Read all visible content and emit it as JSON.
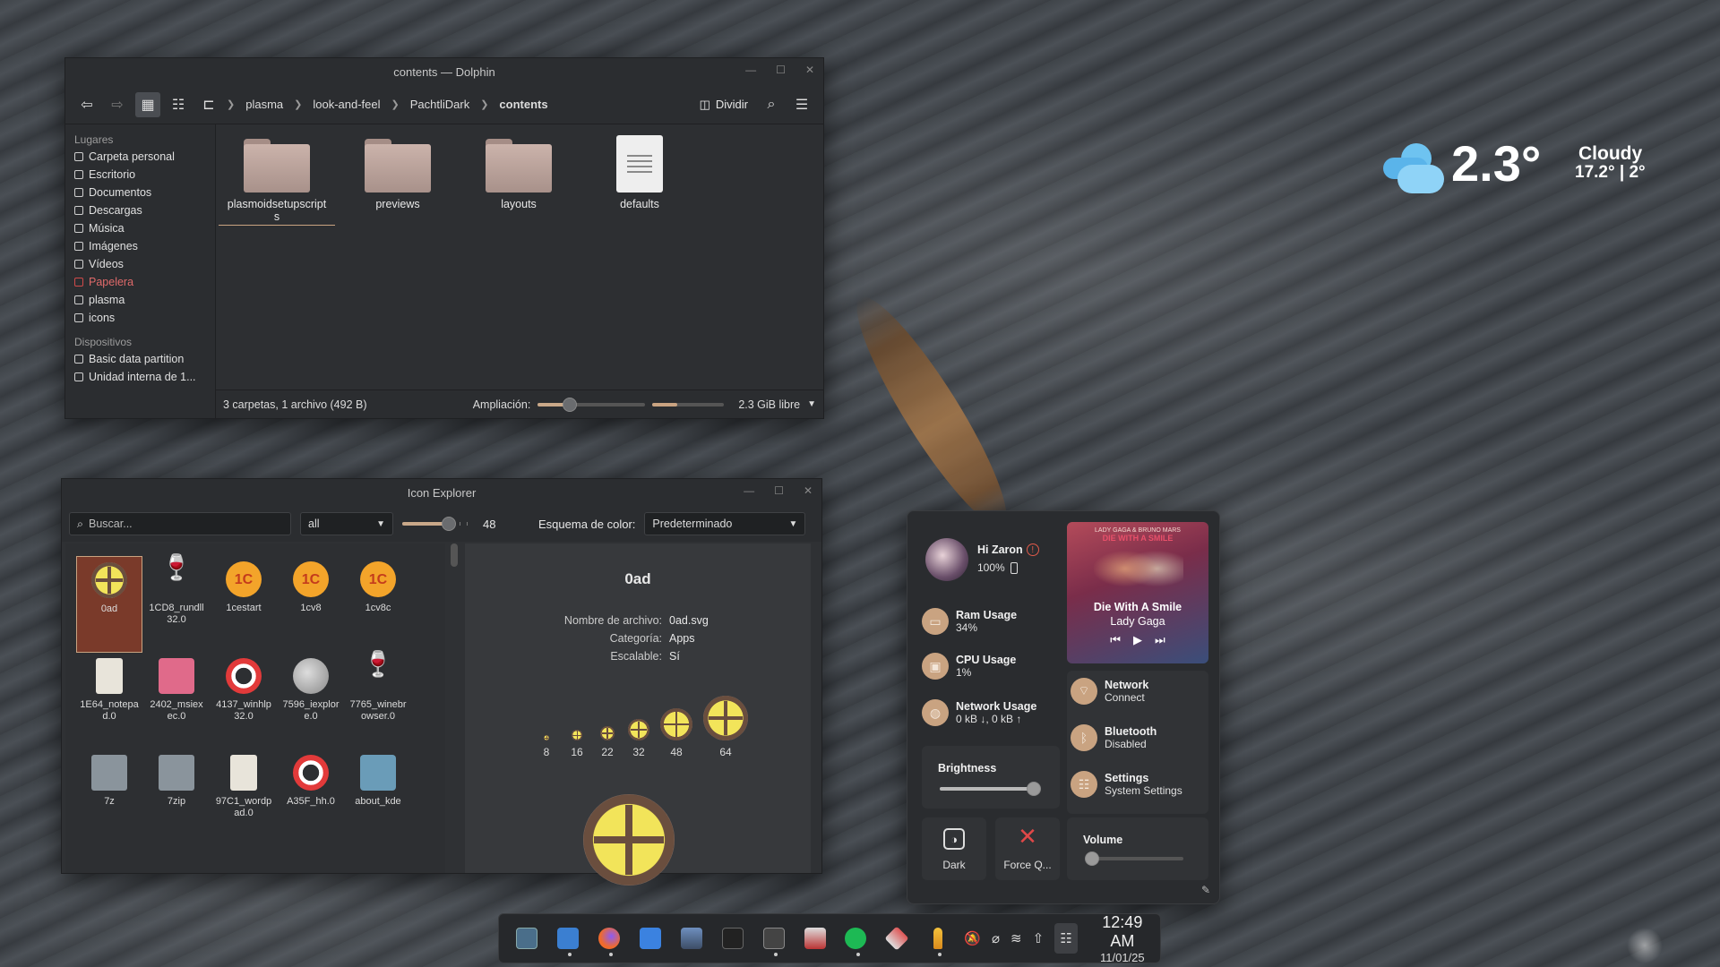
{
  "dolphin": {
    "title": "contents — Dolphin",
    "breadcrumb": [
      "plasma",
      "look-and-feel",
      "PachtliDark",
      "contents"
    ],
    "split_label": "Dividir",
    "places_header": "Lugares",
    "places": [
      "Carpeta personal",
      "Escritorio",
      "Documentos",
      "Descargas",
      "Música",
      "Imágenes",
      "Vídeos",
      "Papelera",
      "plasma",
      "icons"
    ],
    "devices_header": "Dispositivos",
    "devices": [
      "Basic data partition",
      "Unidad interna de 1..."
    ],
    "files": [
      {
        "name": "plasmoidsetupscripts",
        "line1": "plasmoidsetupscript",
        "line2": "s",
        "type": "folder"
      },
      {
        "name": "previews",
        "type": "folder"
      },
      {
        "name": "layouts",
        "type": "folder"
      },
      {
        "name": "defaults",
        "type": "document"
      }
    ],
    "status_text": "3 carpetas, 1 archivo (492 B)",
    "zoom_label": "Ampliación:",
    "zoom_level": 0.3,
    "free_space": "2.3 GiB libre",
    "free_space_used": 0.35
  },
  "icon_explorer": {
    "title": "Icon Explorer",
    "search_placeholder": "Buscar...",
    "filter": "all",
    "size_value": "48",
    "scheme_label": "Esquema de color:",
    "scheme_value": "Predeterminado",
    "icons": [
      {
        "line1": "0ad",
        "line2": "",
        "kind": "oad"
      },
      {
        "line1": "1CD8_rundll",
        "line2": "32.0",
        "kind": "wine"
      },
      {
        "line1": "1cestart",
        "line2": "",
        "kind": "onec"
      },
      {
        "line1": "1cv8",
        "line2": "",
        "kind": "onec"
      },
      {
        "line1": "1cv8c",
        "line2": "",
        "kind": "onec"
      },
      {
        "line1": "1E64_notepa",
        "line2": "d.0",
        "kind": "notepad"
      },
      {
        "line1": "2402_msiex",
        "line2": "ec.0",
        "kind": "disk"
      },
      {
        "line1": "4137_winhlp",
        "line2": "32.0",
        "kind": "lifebuoy"
      },
      {
        "line1": "7596_iexplor",
        "line2": "e.0",
        "kind": "globe"
      },
      {
        "line1": "7765_winebr",
        "line2": "owser.0",
        "kind": "wine"
      },
      {
        "line1": "7z",
        "line2": "",
        "kind": "zip"
      },
      {
        "line1": "7zip",
        "line2": "",
        "kind": "zip"
      },
      {
        "line1": "97C1_wordp",
        "line2": "ad.0",
        "kind": "notepad"
      },
      {
        "line1": "A35F_hh.0",
        "line2": "",
        "kind": "lifebuoy"
      },
      {
        "line1": "about_kde",
        "line2": "",
        "kind": "kde"
      }
    ],
    "detail": {
      "name": "0ad",
      "filename_label": "Nombre de archivo:",
      "filename": "0ad.svg",
      "category_label": "Categoría:",
      "category": "Apps",
      "scalable_label": "Escalable:",
      "scalable": "Sí",
      "sizes": [
        "8",
        "16",
        "22",
        "32",
        "48",
        "64"
      ]
    }
  },
  "weather": {
    "temp": "2.3°",
    "condition": "Cloudy",
    "range": "17.2° | 2°"
  },
  "control_panel": {
    "greeting": "Hi Zaron",
    "battery": "100%",
    "media": {
      "album_text": "LADY GAGA & BRUNO MARS",
      "album_title": "DIE WITH A SMILE",
      "title": "Die With A Smile",
      "artist": "Lady Gaga"
    },
    "ram": {
      "label": "Ram Usage",
      "value": "34%"
    },
    "cpu": {
      "label": "CPU Usage",
      "value": "1%"
    },
    "net_usage": {
      "label": "Network Usage",
      "value": "0 kB ↓, 0 kB ↑"
    },
    "network": {
      "label": "Network",
      "value": "Connect"
    },
    "bluetooth": {
      "label": "Bluetooth",
      "value": "Disabled"
    },
    "settings": {
      "label": "Settings",
      "value": "System Settings"
    },
    "brightness_label": "Brightness",
    "brightness": 0.95,
    "dark_label": "Dark",
    "force_label": "Force Q...",
    "volume_label": "Volume",
    "volume": 0.0
  },
  "taskbar": {
    "time": "12:49 AM",
    "date": "11/01/25"
  },
  "colors": {
    "accent": "#c9a381",
    "window_bg": "#2f3134"
  }
}
